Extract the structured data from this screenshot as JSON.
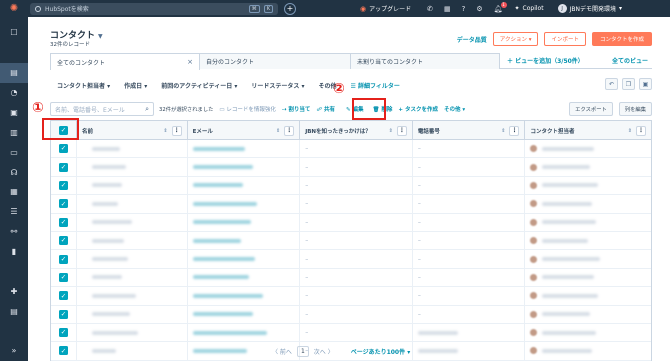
{
  "topbar": {
    "search_placeholder": "HubSpotを検索",
    "kbd1": "⌘",
    "kbd2": "K",
    "upgrade": "アップグレード",
    "notification_count": "1",
    "copilot": "Copilot",
    "account": "JBNデモ開発環境"
  },
  "header": {
    "title": "コンタクト",
    "record_count": "32件のレコード",
    "data_quality": "データ品質",
    "actions": "アクション",
    "import": "インポート",
    "create": "コンタクトを作成"
  },
  "tabs": {
    "all_contacts": "全てのコンタクト",
    "my_contacts": "自分のコンタクト",
    "unassigned": "未割り当てのコンタクト",
    "add_view": "＋ ビューを追加（3/50件）",
    "all_views": "全てのビュー"
  },
  "filters": {
    "owner": "コンタクト担当者",
    "created": "作成日",
    "last_activity": "前回のアクティビティー日",
    "lead_status": "リードステータス",
    "more": "その他",
    "advanced": "詳細フィルター"
  },
  "toolbar": {
    "search_placeholder": "名前、電話番号、Eメール",
    "selected": "32件が選択されました",
    "enrich": "レコードを情報強化",
    "assign": "割り当て",
    "share": "共有",
    "edit": "編集",
    "delete": "削除",
    "create_task": "タスクを作成",
    "more": "その他",
    "export": "エクスポート",
    "edit_columns": "列を編集"
  },
  "table": {
    "columns": [
      "名前",
      "Eメール",
      "JBNを知ったきっかけは？",
      "電話番号",
      "コンタクト担当者"
    ],
    "row_count": 12
  },
  "annotations": {
    "one": "①",
    "two": "②"
  },
  "pagination": {
    "prev": "前へ",
    "page": "1",
    "next": "次へ",
    "per_page": "ページあたり100件"
  },
  "colors": {
    "accent": "#ff7a59",
    "link": "#0091ae",
    "checkbox": "#00a4bd",
    "annotation": "#e4211b",
    "nav": "#213343"
  }
}
